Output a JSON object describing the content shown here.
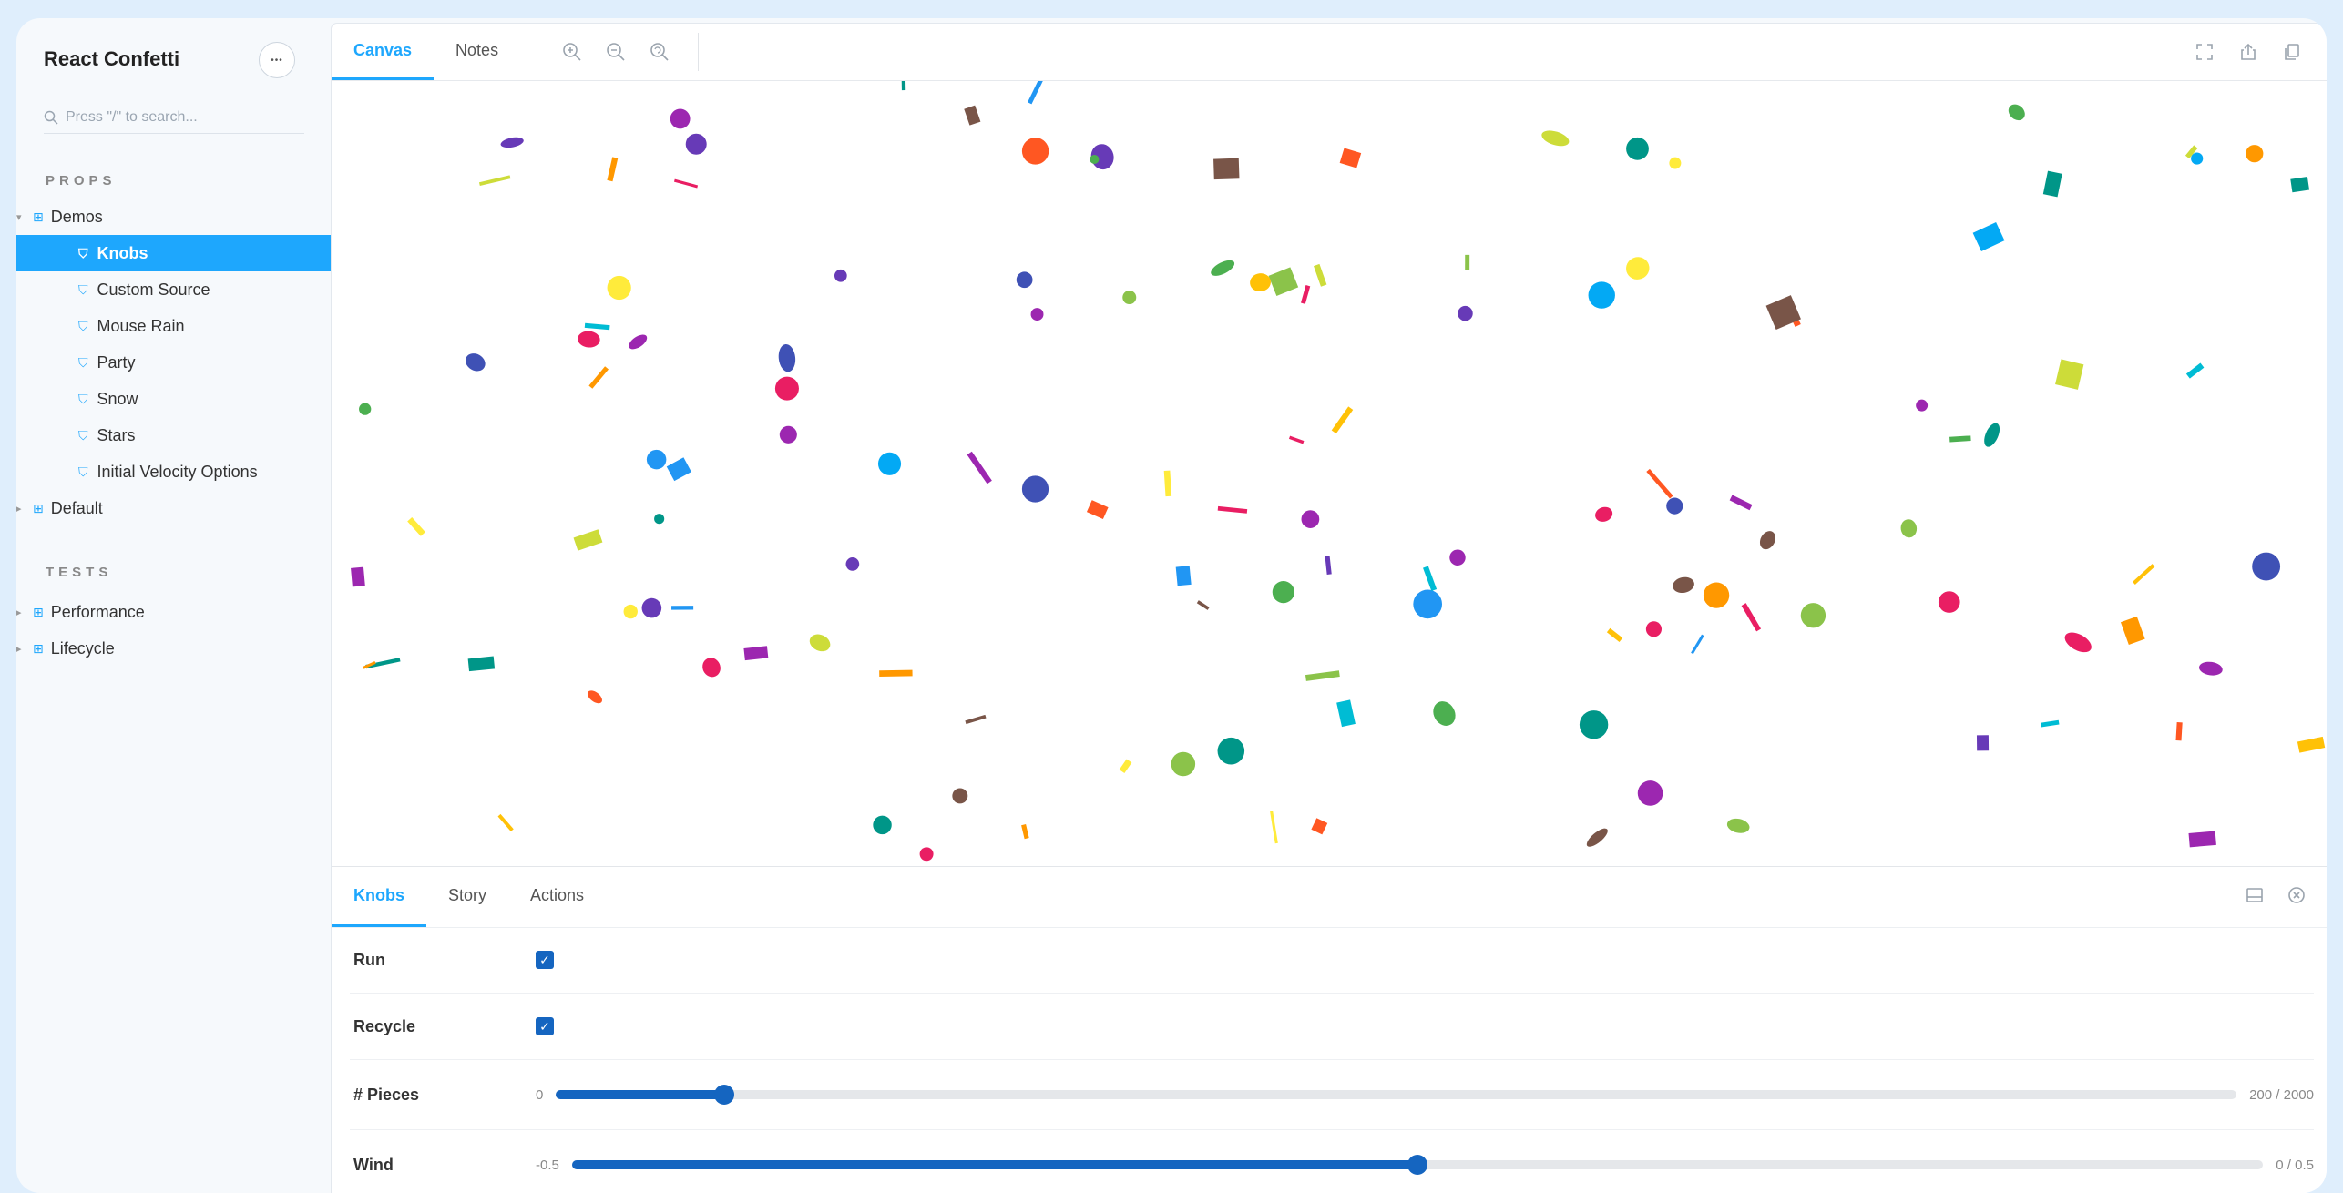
{
  "sidebar": {
    "title": "React Confetti",
    "menu_label": "•••",
    "search_placeholder": "Press \"/\" to search...",
    "props_section": "PROPS",
    "tests_section": "TESTS",
    "groups": {
      "demos": "Demos",
      "default": "Default",
      "performance": "Performance",
      "lifecycle": "Lifecycle"
    },
    "stories": [
      "Knobs",
      "Custom Source",
      "Mouse Rain",
      "Party",
      "Snow",
      "Stars",
      "Initial Velocity Options"
    ],
    "active_story": "Knobs"
  },
  "toolbar": {
    "tabs": [
      "Canvas",
      "Notes"
    ],
    "active_tab": "Canvas",
    "icons": [
      "zoom-in-icon",
      "zoom-out-icon",
      "zoom-reset-icon",
      "fullscreen-icon",
      "share-icon",
      "copy-icon"
    ]
  },
  "addons": {
    "tabs": [
      "Knobs",
      "Story",
      "Actions"
    ],
    "active_tab": "Knobs",
    "icons": [
      "panel-layout-icon",
      "close-icon"
    ],
    "knobs": {
      "run": {
        "label": "Run",
        "checked": true
      },
      "recycle": {
        "label": "Recycle",
        "checked": true
      },
      "pieces": {
        "label": "# Pieces",
        "min": "0",
        "max_text": "200 / 2000",
        "value": 200,
        "max": 2000
      },
      "wind": {
        "label": "Wind",
        "min": "-0.5",
        "max_text": "0 / 0.5",
        "value": 0,
        "min_value": -0.5,
        "max": 0.5
      }
    }
  },
  "colors": {
    "accent": "#1ea7fd",
    "slider": "#1565c0",
    "confetti": [
      "#e91e63",
      "#9c27b0",
      "#673ab7",
      "#3f51b5",
      "#2196f3",
      "#03a9f4",
      "#00bcd4",
      "#009688",
      "#4caf50",
      "#8bc34a",
      "#cddc39",
      "#ffeb3b",
      "#ffc107",
      "#ff9800",
      "#ff5722",
      "#795548"
    ]
  }
}
